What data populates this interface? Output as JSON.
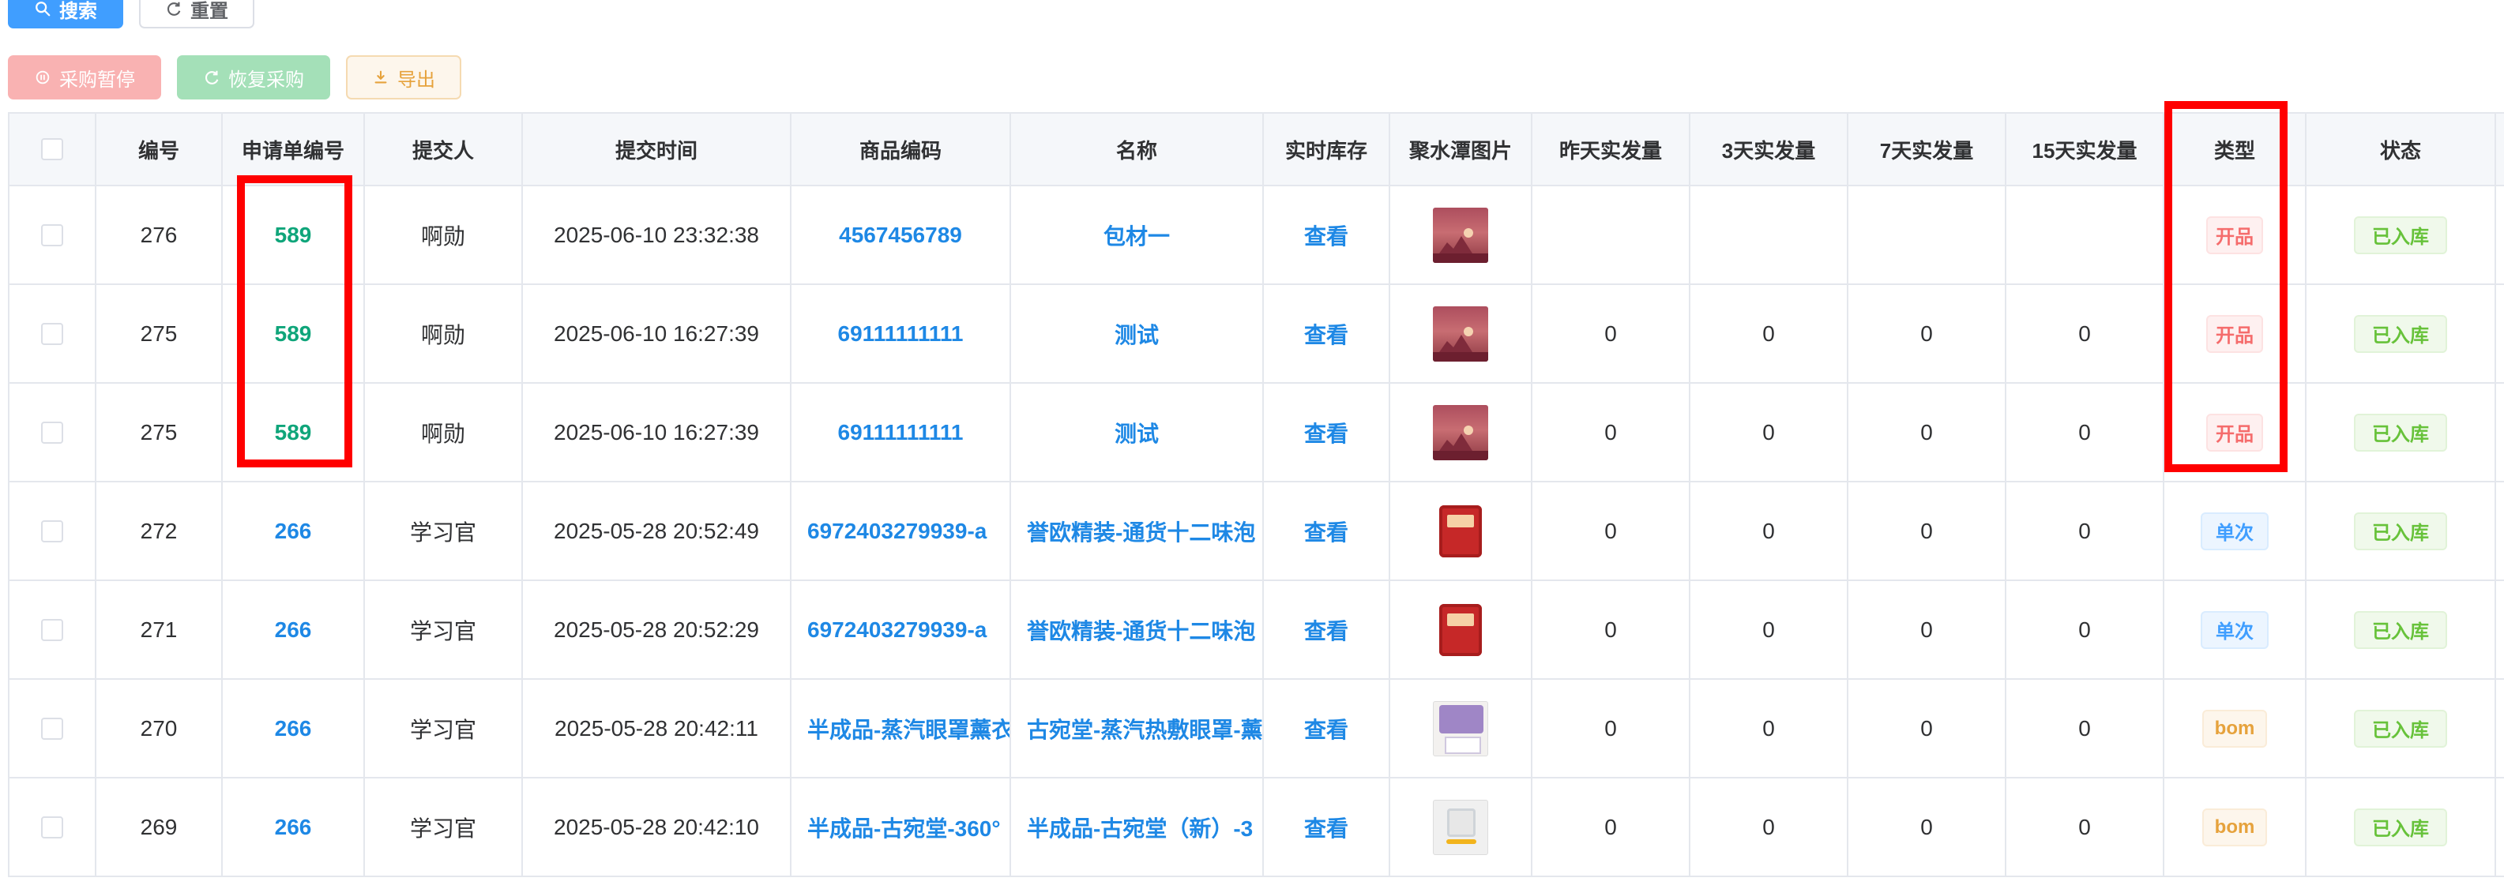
{
  "buttons": {
    "search": "搜索",
    "reset": "重置",
    "stop": "采购暂停",
    "resume": "恢复采购",
    "export": "导出"
  },
  "table": {
    "headers": [
      "编号",
      "申请单编号",
      "提交人",
      "提交时间",
      "商品编码",
      "名称",
      "实时库存",
      "聚水潭图片",
      "昨天实发量",
      "3天实发量",
      "7天实发量",
      "15天实发量",
      "类型",
      "状态"
    ],
    "rows": [
      {
        "id": "276",
        "req": "589",
        "submitter": "啊勋",
        "time": "2025-06-10 23:32:38",
        "code": "4567456789",
        "name": "包材一",
        "stock": "查看",
        "img": "sunset",
        "y1": "",
        "y3": "",
        "y7": "",
        "y15": "",
        "type": "开品",
        "status": "已入库"
      },
      {
        "id": "275",
        "req": "589",
        "submitter": "啊勋",
        "time": "2025-06-10 16:27:39",
        "code": "69111111111",
        "name": "测试",
        "stock": "查看",
        "img": "sunset",
        "y1": "0",
        "y3": "0",
        "y7": "0",
        "y15": "0",
        "type": "开品",
        "status": "已入库"
      },
      {
        "id": "275",
        "req": "589",
        "submitter": "啊勋",
        "time": "2025-06-10 16:27:39",
        "code": "69111111111",
        "name": "测试",
        "stock": "查看",
        "img": "sunset",
        "y1": "0",
        "y3": "0",
        "y7": "0",
        "y15": "0",
        "type": "开品",
        "status": "已入库"
      },
      {
        "id": "272",
        "req": "266",
        "submitter": "学习官",
        "time": "2025-05-28 20:52:49",
        "code": "6972403279939-a",
        "name": "誉欧精装-通货十二味泡",
        "stock": "查看",
        "img": "package",
        "y1": "0",
        "y3": "0",
        "y7": "0",
        "y15": "0",
        "type": "单次",
        "status": "已入库"
      },
      {
        "id": "271",
        "req": "266",
        "submitter": "学习官",
        "time": "2025-05-28 20:52:29",
        "code": "6972403279939-a",
        "name": "誉欧精装-通货十二味泡",
        "stock": "查看",
        "img": "package",
        "y1": "0",
        "y3": "0",
        "y7": "0",
        "y15": "0",
        "type": "单次",
        "status": "已入库"
      },
      {
        "id": "270",
        "req": "266",
        "submitter": "学习官",
        "time": "2025-05-28 20:42:11",
        "code": "半成品-蒸汽眼罩薰衣",
        "name": "古宛堂-蒸汽热敷眼罩-薰",
        "stock": "查看",
        "img": "bag",
        "y1": "0",
        "y3": "0",
        "y7": "0",
        "y15": "0",
        "type": "bom",
        "status": "已入库"
      },
      {
        "id": "269",
        "req": "266",
        "submitter": "学习官",
        "time": "2025-05-28 20:42:10",
        "code": "半成品-古宛堂-360°",
        "name": "半成品-古宛堂（新）-3",
        "stock": "查看",
        "img": "placeholder",
        "y1": "0",
        "y3": "0",
        "y7": "0",
        "y15": "0",
        "type": "bom",
        "status": "已入库"
      }
    ]
  }
}
